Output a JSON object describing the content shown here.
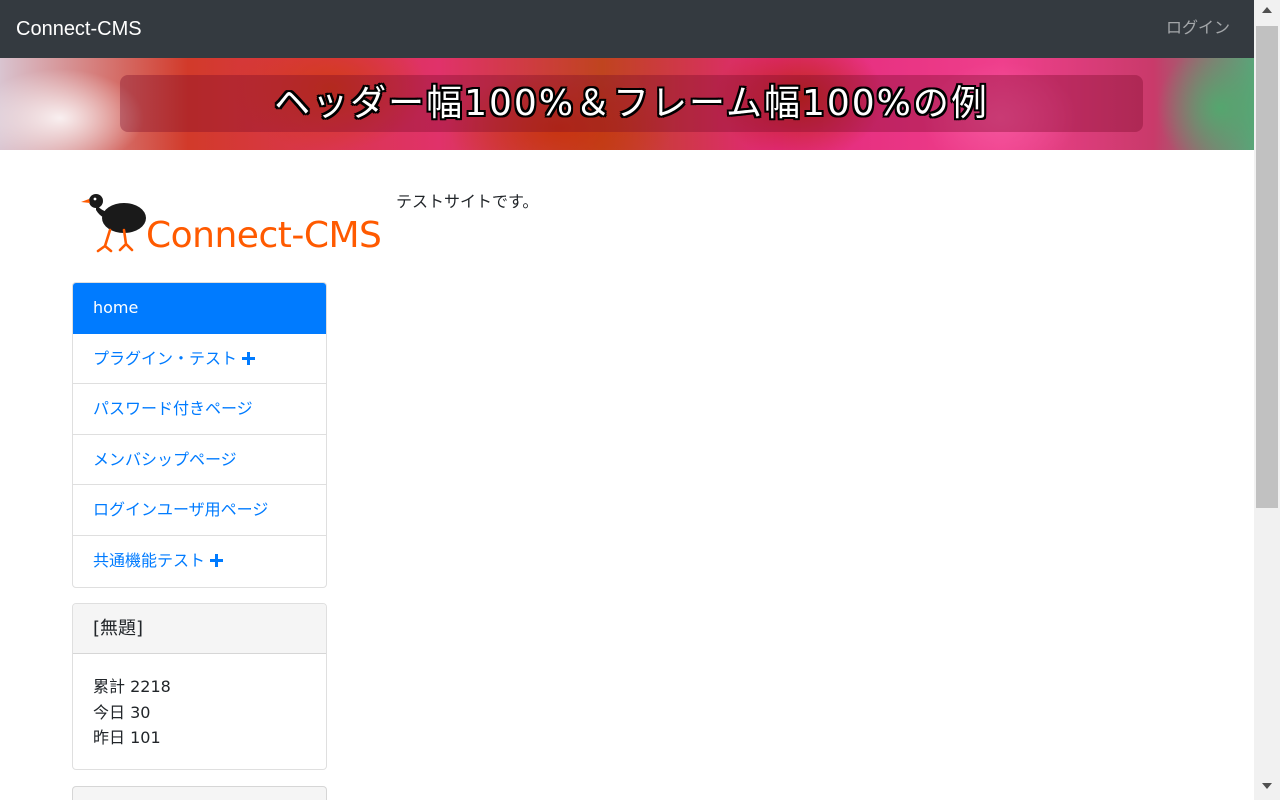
{
  "navbar": {
    "brand": "Connect-CMS",
    "login_label": "ログイン"
  },
  "banner": {
    "title": "ヘッダー幅100%＆フレーム幅100%の例"
  },
  "logo": {
    "text": "Connect-CMS"
  },
  "main": {
    "intro": "テストサイトです。"
  },
  "menu": {
    "items": [
      {
        "label": "home",
        "active": true,
        "expandable": false
      },
      {
        "label": "プラグイン・テスト",
        "active": false,
        "expandable": true
      },
      {
        "label": "パスワード付きページ",
        "active": false,
        "expandable": false
      },
      {
        "label": "メンバシップページ",
        "active": false,
        "expandable": false
      },
      {
        "label": "ログインユーザ用ページ",
        "active": false,
        "expandable": false
      },
      {
        "label": "共通機能テスト",
        "active": false,
        "expandable": true
      }
    ]
  },
  "counter": {
    "title": "[無題]",
    "total": "累計 2218",
    "today": "今日 30",
    "yesterday": "昨日 101"
  },
  "colors": {
    "navbar_bg": "#343a40",
    "primary": "#007bff",
    "logo_orange": "#ff5a00"
  }
}
